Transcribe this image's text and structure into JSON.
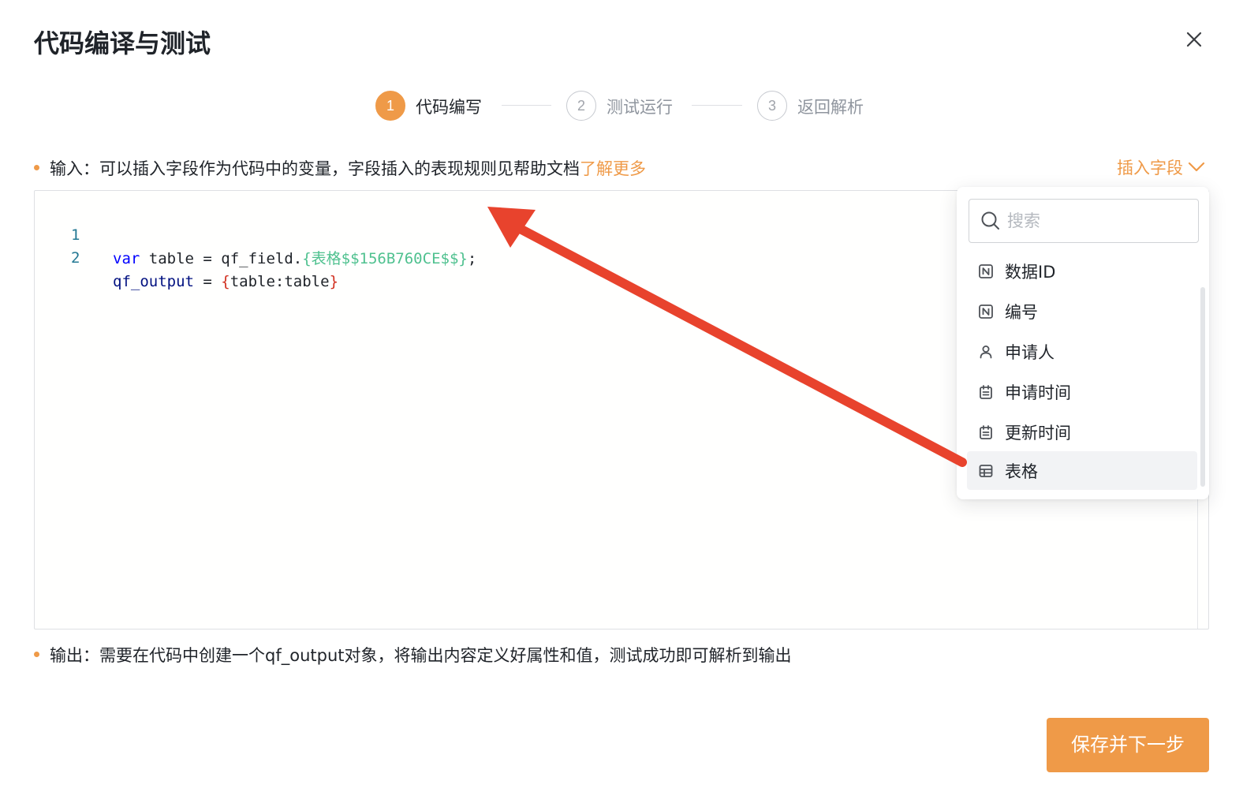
{
  "dialog": {
    "title": "代码编译与测试",
    "close_icon": "close-icon"
  },
  "steps": [
    {
      "number": "1",
      "label": "代码编写",
      "state": "active"
    },
    {
      "number": "2",
      "label": "测试运行",
      "state": "pending"
    },
    {
      "number": "3",
      "label": "返回解析",
      "state": "pending"
    }
  ],
  "input_hint": {
    "text": "输入：可以插入字段作为代码中的变量，字段插入的表现规则见帮助文档",
    "link": "了解更多"
  },
  "insert_field": {
    "label": "插入字段",
    "icon": "chevron-down-icon"
  },
  "code": {
    "lines": [
      {
        "number": "1",
        "t1": "var",
        "t2": " table = qf_field.",
        "t3": "{表格$$156B760CE$$}",
        "t4": ";"
      },
      {
        "number": "2",
        "t1": "qf_output",
        "t2": " = ",
        "t3": "{",
        "t4": "table:table",
        "t5": "}"
      }
    ]
  },
  "dropdown": {
    "search_placeholder": "搜索",
    "items": [
      {
        "label": "数据ID",
        "icon": "number-field-icon"
      },
      {
        "label": "编号",
        "icon": "number-field-icon"
      },
      {
        "label": "申请人",
        "icon": "person-icon"
      },
      {
        "label": "申请时间",
        "icon": "calendar-icon"
      },
      {
        "label": "更新时间",
        "icon": "calendar-icon"
      },
      {
        "label": "表格",
        "icon": "table-icon"
      }
    ],
    "highlighted_item": "表格"
  },
  "output_hint": {
    "text": "输出：需要在代码中创建一个qf_output对象，将输出内容定义好属性和值，测试成功即可解析到输出"
  },
  "footer": {
    "primary_button": "保存并下一步"
  },
  "colors": {
    "accent": "#ef9a48",
    "annotation_arrow": "#e8432d"
  }
}
